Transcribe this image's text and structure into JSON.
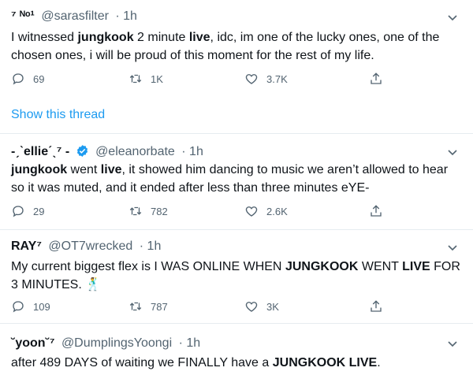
{
  "tweets": [
    {
      "name": "⁷ ᴺᵒ¹",
      "handle": "@sarasfilter",
      "time": "· 1h",
      "text_segments": [
        {
          "t": "I witnessed ",
          "b": false
        },
        {
          "t": "jungkook",
          "b": true
        },
        {
          "t": " 2 minute ",
          "b": false
        },
        {
          "t": "live",
          "b": true
        },
        {
          "t": ", idc, im one of the lucky ones, one of the chosen ones, i will be proud of this moment for the rest of my life.",
          "b": false
        }
      ],
      "reply_count": "69",
      "retweet_count": "1K",
      "like_count": "3.7K"
    },
    {
      "name": "-ˏˋellieˊˎ⁷ -",
      "handle": "@eleanorbate",
      "time": "· 1h",
      "verified": true,
      "text_segments": [
        {
          "t": "jungkook",
          "b": true
        },
        {
          "t": " went ",
          "b": false
        },
        {
          "t": "live",
          "b": true
        },
        {
          "t": ", it showed him dancing to music we aren’t allowed to hear so it was muted, and it ended after less than three minutes eYE-",
          "b": false
        }
      ],
      "reply_count": "29",
      "retweet_count": "782",
      "like_count": "2.6K"
    },
    {
      "name": "RAY⁷",
      "handle": "@OT7wrecked",
      "time": "· 1h",
      "text_segments": [
        {
          "t": "My current biggest flex is I WAS ONLINE WHEN ",
          "b": false
        },
        {
          "t": "JUNGKOOK",
          "b": true
        },
        {
          "t": " WENT ",
          "b": false
        },
        {
          "t": "LIVE",
          "b": true
        },
        {
          "t": " FOR 3 MINUTES. 🕺",
          "b": false
        }
      ],
      "reply_count": "109",
      "retweet_count": "787",
      "like_count": "3K"
    },
    {
      "name": "˘yoon˘⁷",
      "handle": "@DumplingsYoongi",
      "time": "· 1h",
      "text_segments": [
        {
          "t": "after 489 DAYS of waiting we FINALLY have a ",
          "b": false
        },
        {
          "t": "JUNGKOOK LIVE",
          "b": true
        },
        {
          "t": ".",
          "b": false
        }
      ]
    }
  ],
  "show_thread_label": "Show this thread",
  "icons": {
    "reply": "reply-icon",
    "retweet": "retweet-icon",
    "like": "heart-icon",
    "share": "share-icon",
    "caret": "chevron-down-icon",
    "verified": "verified-badge-icon"
  },
  "colors": {
    "text": "#0f1419",
    "secondary": "#536471",
    "link": "#1d9bf0",
    "separator": "#e6ecf0"
  }
}
